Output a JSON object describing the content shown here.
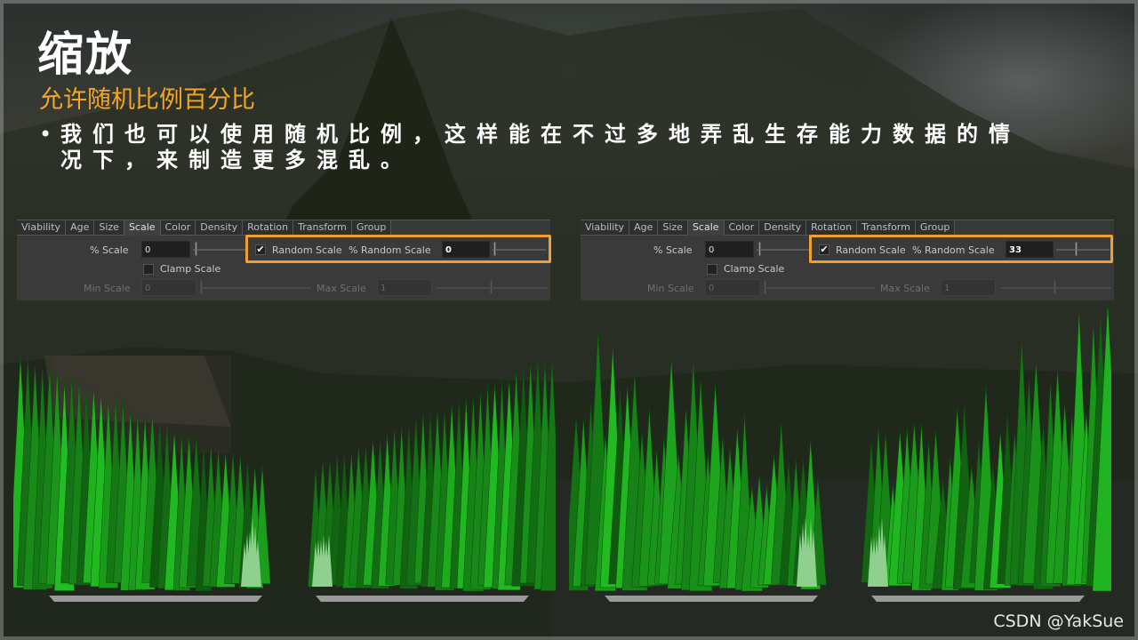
{
  "slide": {
    "title": "缩放",
    "subtitle": "允许随机比例百分比",
    "bullet_dot": "•",
    "bullet_text": "我们也可以使用随机比例，这样能在不过多地弄乱生存能力数据的情况下，来制造更多混乱。",
    "watermark": "CSDN @YakSue",
    "accent_color": "#f5a623",
    "highlight_color": "#f0a030"
  },
  "panels": [
    {
      "tabs": [
        "Viability",
        "Age",
        "Size",
        "Scale",
        "Color",
        "Density",
        "Rotation",
        "Transform",
        "Group"
      ],
      "active_tab": "Scale",
      "percent_scale_label": "% Scale",
      "percent_scale_value": "0",
      "random_scale_label": "Random Scale",
      "random_scale_checked": true,
      "percent_random_scale_label": "% Random Scale",
      "percent_random_scale_value": "0",
      "clamp_scale_label": "Clamp Scale",
      "clamp_scale_checked": false,
      "min_scale_label": "Min Scale",
      "min_scale_value": "0",
      "max_scale_label": "Max Scale",
      "max_scale_value": "1"
    },
    {
      "tabs": [
        "Viability",
        "Age",
        "Size",
        "Scale",
        "Color",
        "Density",
        "Rotation",
        "Transform",
        "Group"
      ],
      "active_tab": "Scale",
      "percent_scale_label": "% Scale",
      "percent_scale_value": "0",
      "random_scale_label": "Random Scale",
      "random_scale_checked": true,
      "percent_random_scale_label": "% Random Scale",
      "percent_random_scale_value": "33",
      "clamp_scale_label": "Clamp Scale",
      "clamp_scale_checked": false,
      "min_scale_label": "Min Scale",
      "min_scale_value": "0",
      "max_scale_label": "Max Scale",
      "max_scale_value": "1"
    }
  ],
  "scenes": [
    {
      "name": "uniform-scale-forest",
      "random_scale_percent": 0,
      "cone_color_dark": "#0f6a10",
      "cone_color_light": "#3fc23f"
    },
    {
      "name": "random-scale-forest",
      "random_scale_percent": 33,
      "cone_color_dark": "#0f6a10",
      "cone_color_light": "#3fc23f"
    }
  ],
  "icons": {
    "checkbox": "check-icon"
  }
}
